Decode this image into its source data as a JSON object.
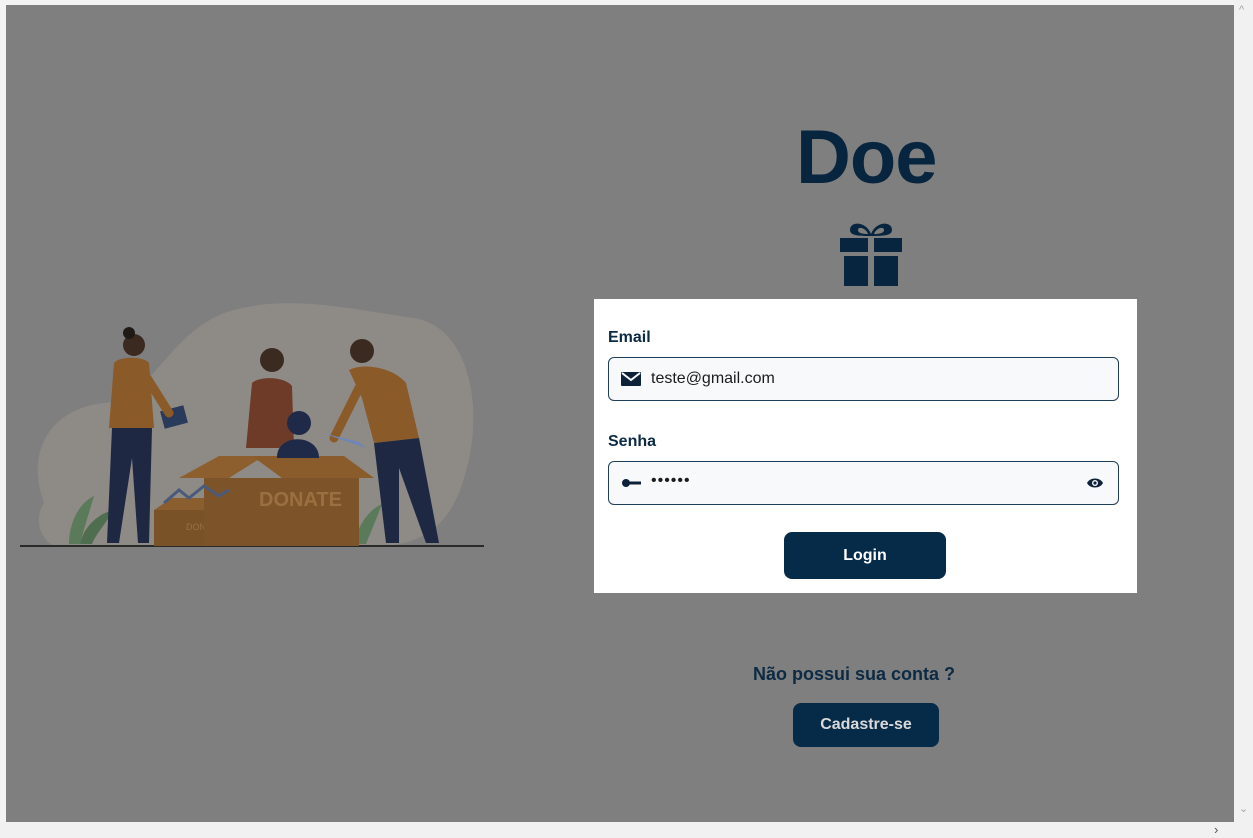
{
  "brand": {
    "title": "Doe"
  },
  "illustration": {
    "box_label_large": "DONATE",
    "box_label_small": "DONATE"
  },
  "login_form": {
    "email_label": "Email",
    "email_value": "teste@gmail.com",
    "password_label": "Senha",
    "password_value": "••••••",
    "login_button": "Login"
  },
  "signup": {
    "prompt": "Não possui sua conta ?",
    "button": "Cadastre-se"
  },
  "colors": {
    "overlay": "#7f7f7f",
    "primary": "#062b49",
    "card": "#ffffff"
  }
}
